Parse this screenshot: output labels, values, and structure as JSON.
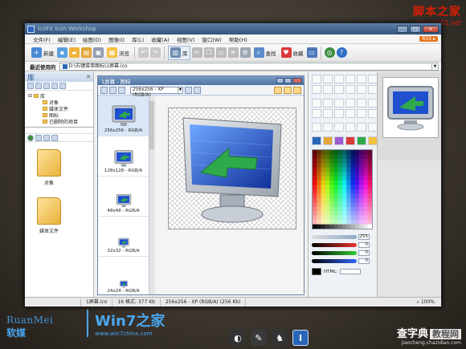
{
  "watermark": {
    "title": "脚本之家",
    "url": "www.Jb51.net"
  },
  "window": {
    "title": "IcoFX Icon Workshop"
  },
  "menu": {
    "items": [
      "文件(F)",
      "编辑(E)",
      "绘图(D)",
      "图像(I)",
      "库(L)",
      "收藏(A)",
      "视图(V)",
      "窗口(W)",
      "帮助(H)"
    ],
    "badge": "R55 ▸"
  },
  "toolbar": {
    "new_label": "新建",
    "browse_label": "浏览",
    "library_label": "库",
    "find_label": "查找",
    "favorites_label": "收藏"
  },
  "recent": {
    "label": "最近使用的",
    "path": "D:\\右键菜单图标\\1屏幕.ico"
  },
  "library": {
    "title": "库",
    "tree_root": "库",
    "tree_items": [
      "对象",
      "媒体文件",
      "图标",
      "已删除的项目"
    ],
    "folders": [
      "对象",
      "媒体文件"
    ]
  },
  "document": {
    "title": "1屏幕 - 图标",
    "format_selected": "256x256 - XP (RGB/A)",
    "formats": [
      "256x256 - RGB/A",
      "128x128 - RGB/A",
      "48x48 - RGB/A",
      "32x32 - RGB/A",
      "24x24 - RGB/A"
    ]
  },
  "color_panel": {
    "values": [
      "255",
      "0",
      "0",
      "0"
    ],
    "hex_label": "HTML:"
  },
  "status": {
    "file": "1屏幕.ico",
    "formats": "16 格式: 377 Kb",
    "current": "256x256 - XP (RGB/A) (256 Kb)",
    "zoom": "100%"
  },
  "brand": {
    "left_en": "RuanMei",
    "left_cn": "软媒",
    "win7": "Win7之家",
    "win7_url": "www.win7china.com",
    "right_cn": "查字典",
    "right_box": "教程网",
    "right_url": "jiaocheng.chazidian.com"
  },
  "colors": {
    "titlebar": "#34557d",
    "accent": "#2a66b8",
    "folder": "#e8b23a",
    "screen_blue": "#1e4fcf",
    "arrow_green": "#2faa4a"
  }
}
